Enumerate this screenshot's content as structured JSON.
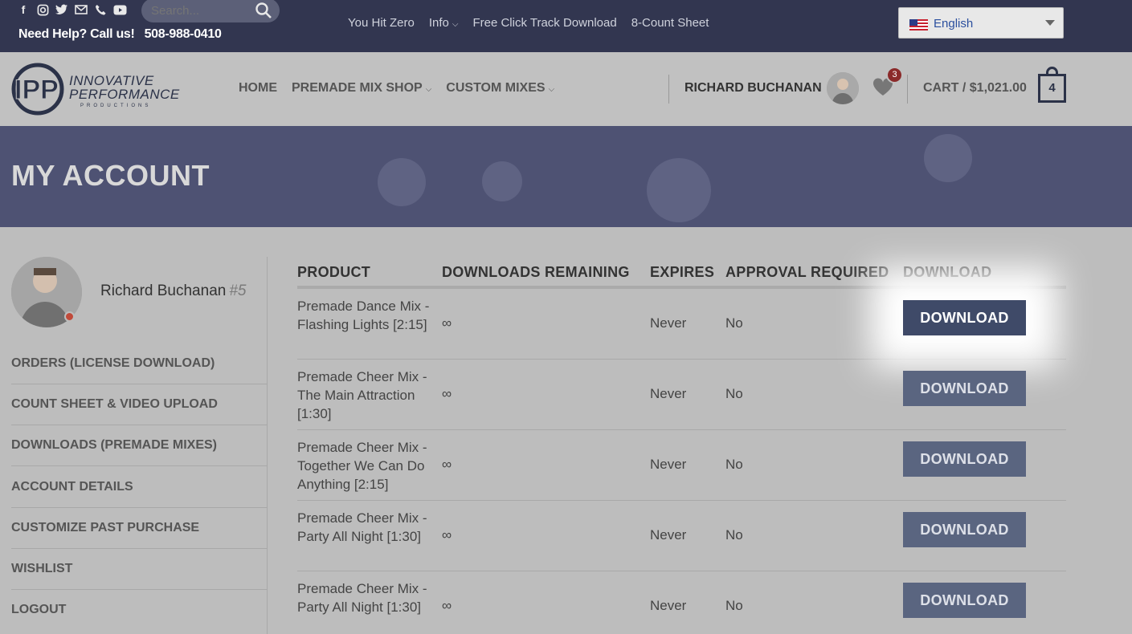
{
  "topbar": {
    "social_icons": [
      "facebook-icon",
      "instagram-icon",
      "twitter-icon",
      "email-icon",
      "phone-icon",
      "youtube-icon"
    ],
    "search_placeholder": "Search...",
    "help_text": "Need Help? Call us!",
    "phone": "508-988-0410",
    "links": [
      {
        "label": "You Hit Zero"
      },
      {
        "label": "Info"
      },
      {
        "label": "Free Click Track Download"
      },
      {
        "label": "8-Count Sheet"
      }
    ],
    "language": "English"
  },
  "header": {
    "logo": {
      "line1": "INNOVATIVE",
      "line2": "PERFORMANCE",
      "line3": "PRODUCTIONS"
    },
    "nav": [
      {
        "label": "HOME"
      },
      {
        "label": "PREMADE MIX SHOP"
      },
      {
        "label": "CUSTOM MIXES"
      }
    ],
    "user_name": "RICHARD BUCHANAN",
    "wishlist_count": "3",
    "cart_label": "CART / $1,021.00",
    "cart_count": "4"
  },
  "banner": {
    "title": "MY ACCOUNT"
  },
  "sidebar": {
    "name": "Richard Buchanan",
    "user_number": "#5",
    "items": [
      {
        "label": "ORDERS (LICENSE DOWNLOAD)"
      },
      {
        "label": "COUNT SHEET & VIDEO UPLOAD"
      },
      {
        "label": "DOWNLOADS (PREMADE MIXES)"
      },
      {
        "label": "ACCOUNT DETAILS"
      },
      {
        "label": "CUSTOMIZE PAST PURCHASE"
      },
      {
        "label": "WISHLIST"
      },
      {
        "label": "LOGOUT"
      }
    ]
  },
  "table": {
    "headers": [
      "PRODUCT",
      "DOWNLOADS REMAINING",
      "EXPIRES",
      "APPROVAL REQUIRED",
      "DOWNLOAD"
    ],
    "rows": [
      {
        "product": "Premade Dance Mix - Flashing Lights [2:15]",
        "remaining": "∞",
        "expires": "Never",
        "approval": "No",
        "button": "DOWNLOAD"
      },
      {
        "product": "Premade Cheer Mix - The Main Attraction [1:30]",
        "remaining": "∞",
        "expires": "Never",
        "approval": "No",
        "button": "DOWNLOAD"
      },
      {
        "product": "Premade Cheer Mix - Together We Can Do Anything [2:15]",
        "remaining": "∞",
        "expires": "Never",
        "approval": "No",
        "button": "DOWNLOAD"
      },
      {
        "product": "Premade Cheer Mix - Party All Night [1:30]",
        "remaining": "∞",
        "expires": "Never",
        "approval": "No",
        "button": "DOWNLOAD"
      },
      {
        "product": "Premade Cheer Mix - Party All Night [1:30]",
        "remaining": "∞",
        "expires": "Never",
        "approval": "No",
        "button": "DOWNLOAD"
      }
    ]
  },
  "colors": {
    "topbar": "#323650",
    "banner": "#4e5273",
    "button": "#5a6580",
    "accent": "#2b3248"
  }
}
